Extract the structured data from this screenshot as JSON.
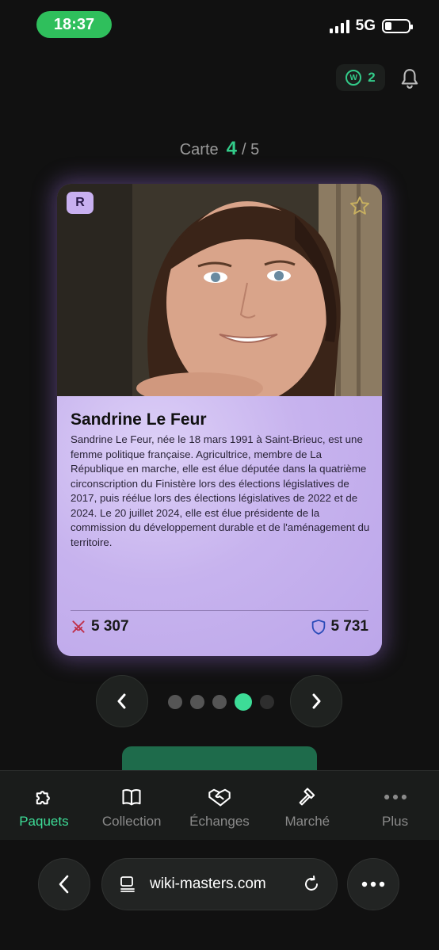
{
  "status_bar": {
    "time": "18:37",
    "network": "5G",
    "battery_icon": "battery-low-icon",
    "signal_icon": "signal-bars-icon"
  },
  "header": {
    "coin_count": "2",
    "coin_symbol": "W",
    "coin_icon": "wiki-coin-icon",
    "notification_icon": "bell-icon"
  },
  "counter": {
    "label": "Carte",
    "current": "4",
    "total": "/ 5"
  },
  "card": {
    "rarity": "R",
    "favorite_icon": "star-outline-icon",
    "name": "Sandrine Le Feur",
    "description": "Sandrine Le Feur, née le 18 mars 1991 à Saint-Brieuc, est une femme politique française. Agricultrice, membre de La République en marche, elle est élue députée dans la quatrième circonscription du Finistère lors des élections législatives de 2017, puis réélue lors des élections législatives de 2022 et de 2024. Le 20 juillet 2024, elle est élue présidente de la commission du développement durable et de l'aménagement du territoire.",
    "attack": "5 307",
    "defense": "5 731",
    "attack_icon": "crossed-swords-icon",
    "defense_icon": "shield-icon"
  },
  "carousel": {
    "count": 5,
    "active_index": 3,
    "prev_icon": "chevron-left-icon",
    "next_icon": "chevron-right-icon"
  },
  "cta": {
    "label": ""
  },
  "tabs": [
    {
      "label": "Paquets",
      "icon": "puzzle-icon",
      "active": true
    },
    {
      "label": "Collection",
      "icon": "book-icon",
      "active": false
    },
    {
      "label": "Échanges",
      "icon": "handshake-icon",
      "active": false
    },
    {
      "label": "Marché",
      "icon": "gavel-icon",
      "active": false
    },
    {
      "label": "Plus",
      "icon": "more-dots-icon",
      "active": false
    }
  ],
  "browser": {
    "url": "wiki-masters.com",
    "back_icon": "arrow-left-icon",
    "reader_icon": "reader-icon",
    "reload_icon": "reload-icon",
    "more_icon": "ellipsis-icon"
  },
  "colors": {
    "accent": "#3ddc97",
    "card_bg": "#c9b6ee",
    "background": "#111111",
    "time_pill": "#2fbf5c"
  }
}
